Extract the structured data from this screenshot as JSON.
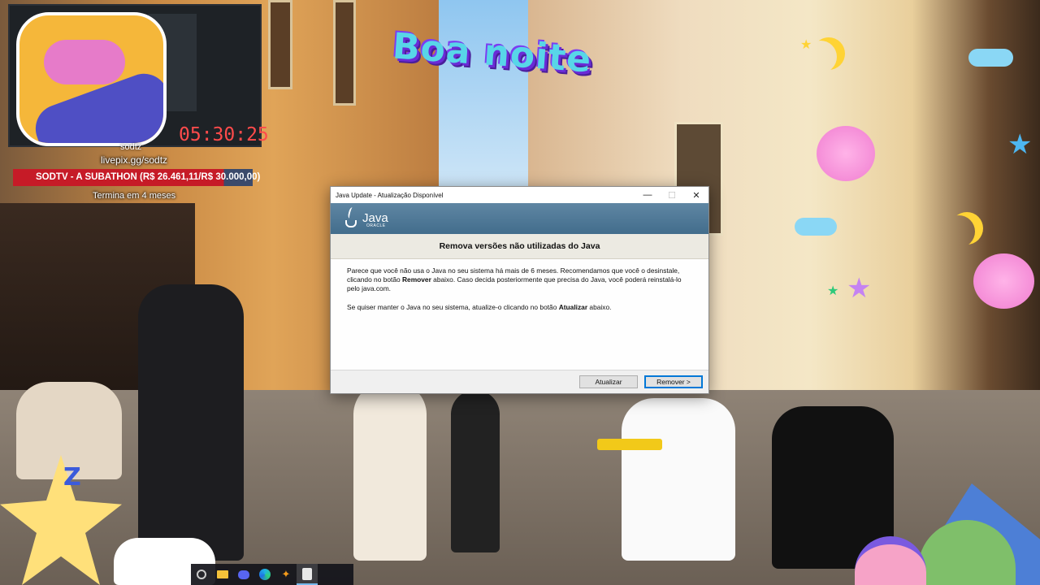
{
  "stream": {
    "timer": "05:30:25",
    "channel_partial": "sodtz",
    "livepix_url": "livepix.gg/sodtz",
    "subathon_label": "SODTV - A SUBATHON (R$ 26.461,11/R$ 30.000,00)",
    "ends_in": "Termina em 4 meses",
    "greeting": "Boa noite"
  },
  "dialog": {
    "window_title": "Java Update - Atualização Disponível",
    "controls": {
      "minimize": "—",
      "maximize": "☐",
      "close": "✕"
    },
    "brand": {
      "name": "Java",
      "vendor": "ORACLE"
    },
    "heading": "Remova versões não utilizadas do Java",
    "para1_a": "Parece que você não usa o Java no seu sistema há mais de 6 meses. Recomendamos que você o desinstale, clicando no botão ",
    "para1_bold": "Remover",
    "para1_b": " abaixo. Caso decida posteriormente que precisa do Java, você poderá reinstalá-lo pelo java.com.",
    "para2_a": "Se quiser manter o Java no seu sistema, atualize-o clicando no botão ",
    "para2_bold": "Atualizar",
    "para2_b": " abaixo.",
    "buttons": {
      "update": "Atualizar",
      "remove": "Remover >"
    }
  },
  "taskbar": {
    "items": [
      "search-icon",
      "file-explorer-icon",
      "discord-icon",
      "edge-icon",
      "app-icon",
      "java-icon"
    ]
  },
  "colors": {
    "subathon_red": "#c61b27",
    "timer_red": "#ff4b4b",
    "java_banner": "#4f7897",
    "default_button_border": "#0078d7"
  }
}
